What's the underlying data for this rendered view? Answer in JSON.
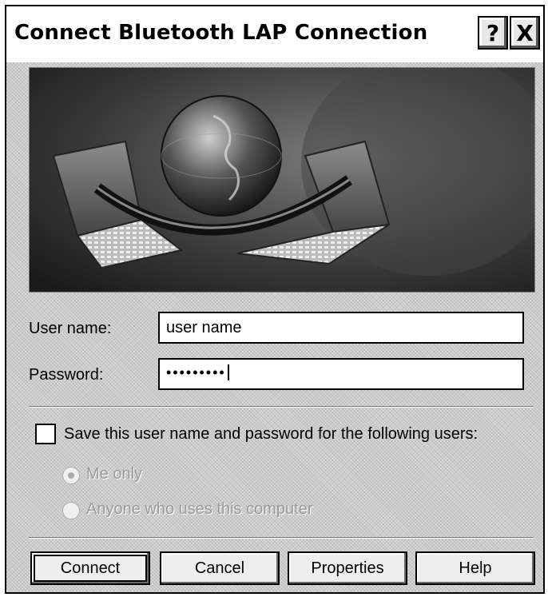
{
  "window": {
    "title": "Connect Bluetooth LAP Connection",
    "help_glyph": "?",
    "close_glyph": "X"
  },
  "form": {
    "username_label": "User name:",
    "username_value": "user name",
    "password_label": "Password:",
    "password_value": "•••••••••"
  },
  "save": {
    "checkbox_label": "Save this user name and password for the following users:",
    "checked": false,
    "options": [
      {
        "label": "Me only",
        "selected": true
      },
      {
        "label": "Anyone who uses this computer",
        "selected": false
      }
    ]
  },
  "buttons": {
    "connect": "Connect",
    "cancel": "Cancel",
    "properties": "Properties",
    "help": "Help"
  },
  "icons": [
    "help-icon",
    "close-icon",
    "globe-laptops-banner"
  ]
}
